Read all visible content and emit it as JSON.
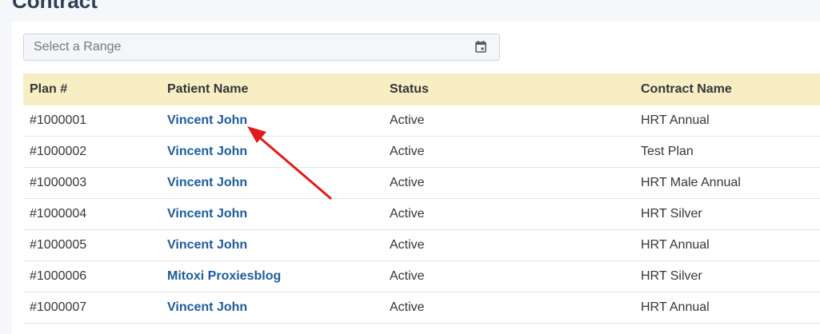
{
  "page": {
    "title": "Contract"
  },
  "filter": {
    "placeholder": "Select a Range",
    "icon": "calendar-icon"
  },
  "table": {
    "headers": [
      "Plan #",
      "Patient Name",
      "Status",
      "Contract Name"
    ],
    "header_color": "#f8eec4",
    "link_color": "#1e5c99",
    "rows": [
      {
        "plan": "#1000001",
        "patient": "Vincent John",
        "status": "Active",
        "contract": "HRT Annual"
      },
      {
        "plan": "#1000002",
        "patient": "Vincent John",
        "status": "Active",
        "contract": "Test Plan"
      },
      {
        "plan": "#1000003",
        "patient": "Vincent John",
        "status": "Active",
        "contract": "HRT Male Annual"
      },
      {
        "plan": "#1000004",
        "patient": "Vincent John",
        "status": "Active",
        "contract": "HRT Silver"
      },
      {
        "plan": "#1000005",
        "patient": "Vincent John",
        "status": "Active",
        "contract": "HRT Annual"
      },
      {
        "plan": "#1000006",
        "patient": "Mitoxi Proxiesblog",
        "status": "Active",
        "contract": "HRT Silver"
      },
      {
        "plan": "#1000007",
        "patient": "Vincent John",
        "status": "Active",
        "contract": "HRT Annual"
      }
    ]
  },
  "annotation": {
    "arrow_color": "#e0191b"
  }
}
